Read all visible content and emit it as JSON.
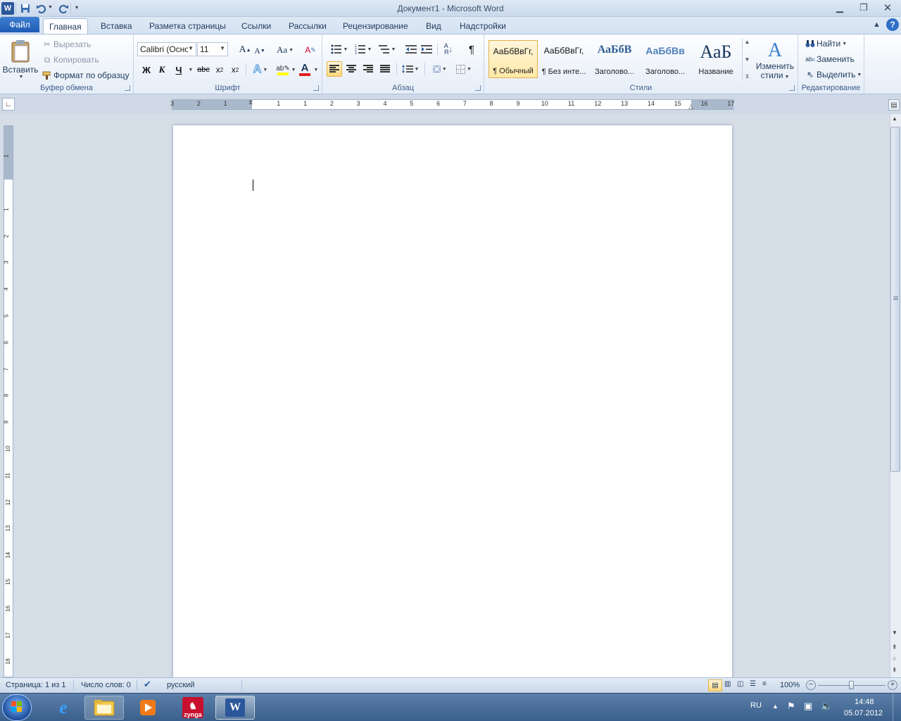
{
  "window": {
    "title": "Документ1 - Microsoft Word"
  },
  "quick_access": {
    "icons": [
      "word-logo-icon",
      "save-icon",
      "undo-icon",
      "redo-icon",
      "customize-icon"
    ]
  },
  "tabs": [
    {
      "label": "Файл"
    },
    {
      "label": "Главная"
    },
    {
      "label": "Вставка"
    },
    {
      "label": "Разметка страницы"
    },
    {
      "label": "Ссылки"
    },
    {
      "label": "Рассылки"
    },
    {
      "label": "Рецензирование"
    },
    {
      "label": "Вид"
    },
    {
      "label": "Надстройки"
    }
  ],
  "clipboard": {
    "paste_label": "Вставить",
    "cut_label": "Вырезать",
    "copy_label": "Копировать",
    "format_painter_label": "Формат по образцу",
    "group_label": "Буфер обмена"
  },
  "font": {
    "font_name": "Calibri (Осно",
    "font_size": "11",
    "bold": "Ж",
    "italic": "К",
    "underline": "Ч",
    "strike": "abc",
    "aa_label": "Aa",
    "grow": "A",
    "shrink": "A",
    "group_label": "Шрифт",
    "highlight_color": "#ffff00",
    "font_color": "#e02020"
  },
  "paragraph": {
    "group_label": "Абзац",
    "pilcrow": "¶"
  },
  "styles": {
    "group_label": "Стили",
    "items": [
      {
        "preview": "АаБбВвГг,",
        "name": "¶ Обычный"
      },
      {
        "preview": "АаБбВвГг,",
        "name": "¶ Без инте..."
      },
      {
        "preview": "АаБбВ",
        "name": "Заголово..."
      },
      {
        "preview": "АаБбВв",
        "name": "Заголово..."
      },
      {
        "preview": "АаБ",
        "name": "Название"
      }
    ],
    "change_styles_line1": "Изменить",
    "change_styles_line2": "стили"
  },
  "editing": {
    "group_label": "Редактирование",
    "find_label": "Найти",
    "replace_label": "Заменить",
    "select_label": "Выделить"
  },
  "hruler_labels": [
    "3",
    "2",
    "1",
    "1",
    "1",
    "2",
    "3",
    "4",
    "5",
    "6",
    "7",
    "8",
    "9",
    "10",
    "11",
    "12",
    "13",
    "14",
    "15",
    "16",
    "17"
  ],
  "vruler_labels": [
    "1",
    "1",
    "2",
    "3",
    "4",
    "5",
    "6",
    "7",
    "8",
    "9",
    "10",
    "11",
    "12",
    "13",
    "14",
    "15",
    "16",
    "17",
    "18"
  ],
  "statusbar": {
    "page": "Страница: 1 из 1",
    "words": "Число слов: 0",
    "language": "русский",
    "zoom": "100%"
  },
  "taskbar": {
    "lang": "RU",
    "time": "14:48",
    "date": "05.07.2012",
    "zynga_label": "zynga"
  }
}
